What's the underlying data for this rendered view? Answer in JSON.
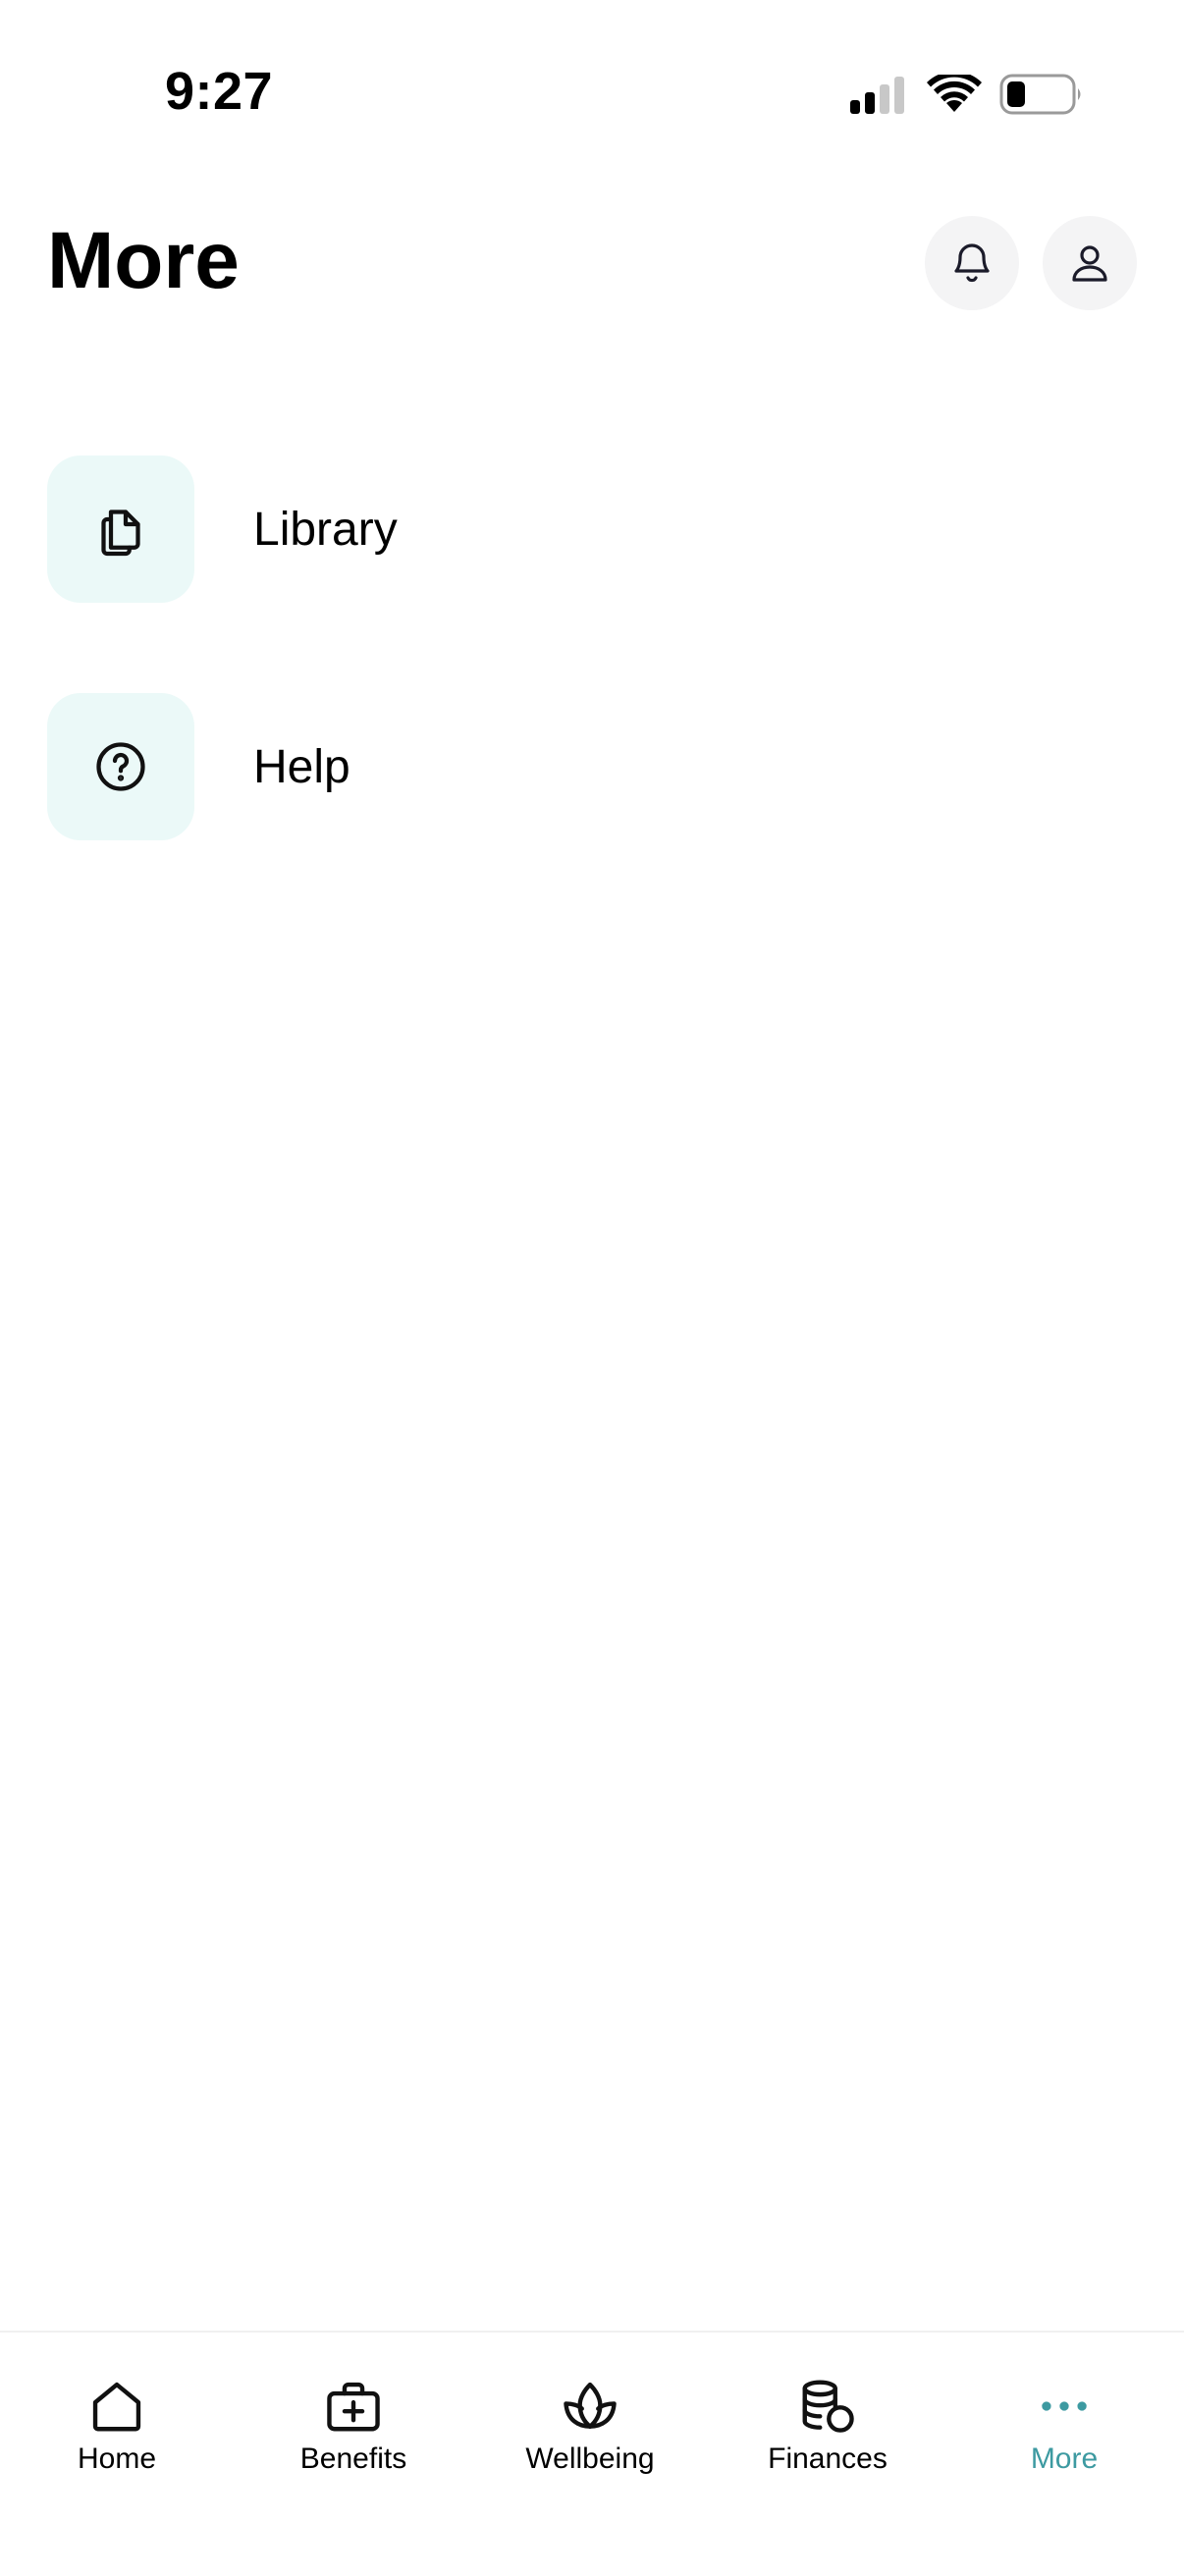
{
  "status_bar": {
    "time": "9:27"
  },
  "header": {
    "title": "More",
    "icons": {
      "bell": "bell-icon",
      "profile": "user-icon"
    }
  },
  "menu": {
    "items": [
      {
        "label": "Library",
        "icon": "documents-icon"
      },
      {
        "label": "Help",
        "icon": "question-circle-icon"
      }
    ]
  },
  "tab_bar": {
    "active": "More",
    "accent_color": "#3d9aa1",
    "tabs": [
      {
        "label": "Home",
        "icon": "home-icon"
      },
      {
        "label": "Benefits",
        "icon": "medical-kit-icon"
      },
      {
        "label": "Wellbeing",
        "icon": "lotus-icon"
      },
      {
        "label": "Finances",
        "icon": "coins-icon"
      },
      {
        "label": "More",
        "icon": "more-dots-icon"
      }
    ]
  },
  "colors": {
    "icon_tile_bg": "#ebf9f8",
    "header_button_bg": "#f4f4f5"
  }
}
